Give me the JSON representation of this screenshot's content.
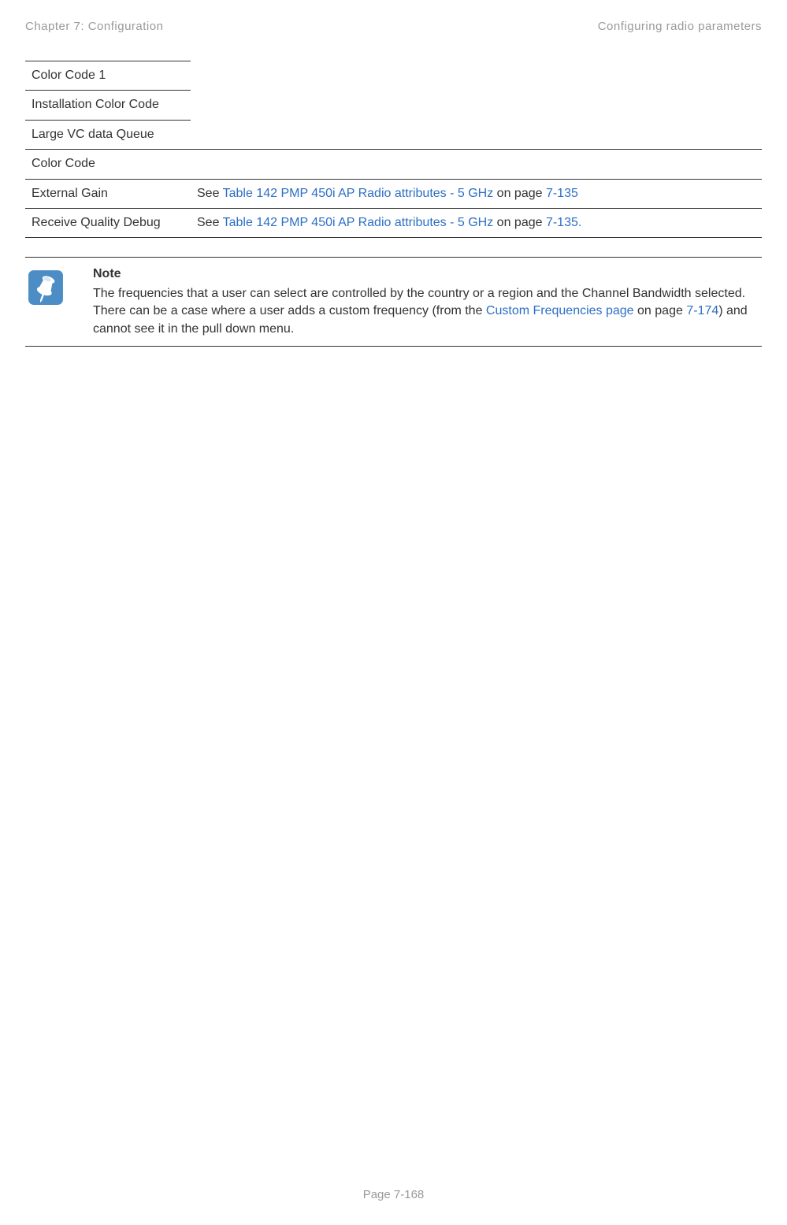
{
  "header": {
    "chapter": "Chapter 7:  Configuration",
    "section": "Configuring radio parameters"
  },
  "table": {
    "rows": [
      {
        "left": "Color Code 1",
        "right": "",
        "partial": true
      },
      {
        "left": "Installation Color Code",
        "right": "",
        "partial": true
      },
      {
        "left": "Large VC data Queue",
        "right": "",
        "partial": true
      },
      {
        "left": "Color Code",
        "right": "",
        "partial": false
      },
      {
        "left": "External Gain",
        "right_prefix": "See ",
        "right_link": "Table 142 PMP 450i AP Radio attributes - 5 GHz ",
        "right_mid": " on page ",
        "right_page": "7-135",
        "right_suffix": "",
        "partial": false,
        "has_link": true
      },
      {
        "left": "Receive Quality Debug",
        "right_prefix": "See ",
        "right_link": "Table 142 PMP 450i AP Radio attributes - 5 GHz ",
        "right_mid": " on page ",
        "right_page": "7-135.",
        "right_suffix": "",
        "partial": false,
        "has_link": true
      }
    ]
  },
  "note": {
    "heading": "Note",
    "body_pre": "The frequencies that a user can select are controlled by the country or a region and the Channel Bandwidth selected. There can be a case where a user adds a custom frequency (from the ",
    "body_link": "Custom Frequencies page",
    "body_mid": " on page ",
    "body_page": "7-174",
    "body_post": ") and cannot see it in the pull down menu."
  },
  "footer": {
    "page": "Page 7-168"
  }
}
